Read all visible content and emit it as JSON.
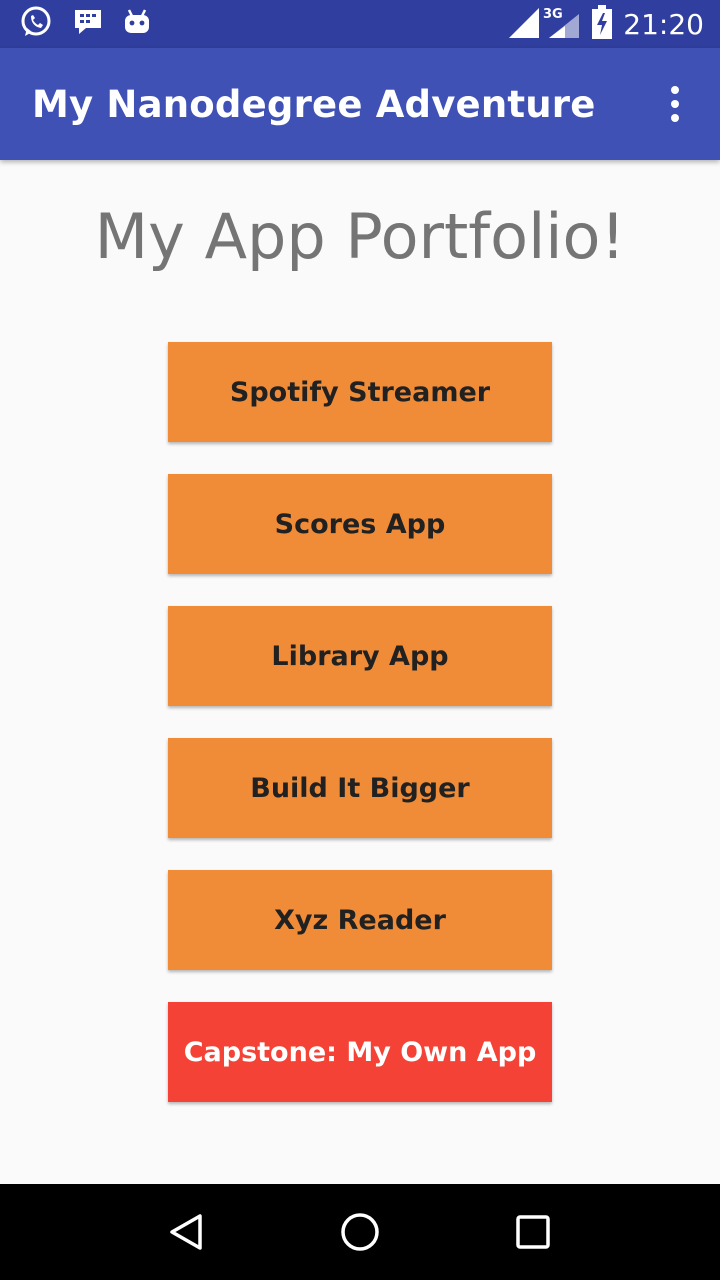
{
  "status_bar": {
    "time": "21:20",
    "network": "3G",
    "icons": [
      "whatsapp-icon",
      "bbm-icon",
      "android-icon",
      "signal-icon",
      "battery-charging-icon"
    ]
  },
  "app_bar": {
    "title": "My Nanodegree Adventure",
    "overflow_icon": "overflow-menu-icon"
  },
  "main": {
    "heading": "My App Portfolio!",
    "buttons": [
      {
        "label": "Spotify Streamer",
        "color": "#f08c38"
      },
      {
        "label": "Scores App",
        "color": "#f08c38"
      },
      {
        "label": "Library App",
        "color": "#f08c38"
      },
      {
        "label": "Build It Bigger",
        "color": "#f08c38"
      },
      {
        "label": "Xyz Reader",
        "color": "#f08c38"
      },
      {
        "label": "Capstone: My Own App",
        "color": "#f44336"
      }
    ]
  },
  "nav_bar": {
    "icons": [
      "back-icon",
      "home-icon",
      "recents-icon"
    ]
  },
  "colors": {
    "primary_dark": "#303f9f",
    "primary": "#3f51b5",
    "accent_orange": "#f08c38",
    "accent_red": "#f44336"
  }
}
